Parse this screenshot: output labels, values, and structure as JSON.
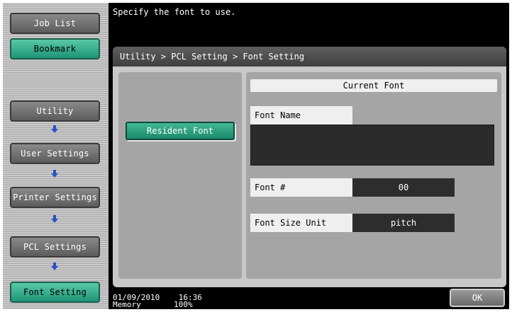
{
  "left_nav": {
    "job_list": "Job List",
    "bookmark": "Bookmark",
    "path": [
      "Utility",
      "User Settings",
      "Printer Settings",
      "PCL Settings",
      "Font Setting"
    ]
  },
  "message": "Specify the font to use.",
  "breadcrumb": "Utility > PCL Setting > Font Setting",
  "resident_font_button": "Resident Font",
  "current_font": {
    "header": "Current Font",
    "font_name_label": "Font Name",
    "font_name_value": "",
    "font_number_label": "Font #",
    "font_number_value": "00",
    "font_size_unit_label": "Font Size Unit",
    "font_size_unit_value": "pitch"
  },
  "status": {
    "date": "01/09/2010",
    "time": "16:36",
    "memory_label": "Memory",
    "memory_value": "100%"
  },
  "ok_button": "OK",
  "colors": {
    "accent_green": "#1e9477",
    "dark": "#2d2d2d"
  }
}
